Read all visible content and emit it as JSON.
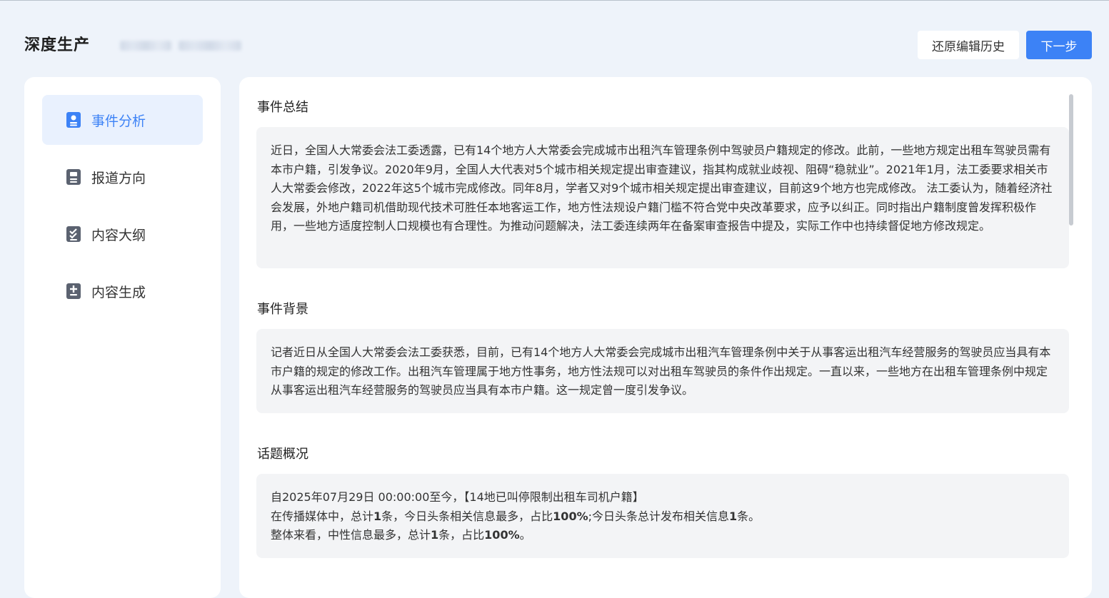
{
  "header": {
    "title": "深度生产",
    "restore_label": "还原编辑历史",
    "next_label": "下一步"
  },
  "sidebar": {
    "items": [
      {
        "label": "事件分析",
        "icon": "person-card-icon",
        "active": true
      },
      {
        "label": "报道方向",
        "icon": "document-icon",
        "active": false
      },
      {
        "label": "内容大纲",
        "icon": "checklist-icon",
        "active": false
      },
      {
        "label": "内容生成",
        "icon": "add-document-icon",
        "active": false
      }
    ]
  },
  "main": {
    "summary": {
      "title": "事件总结",
      "text": "近日，全国人大常委会法工委透露，已有14个地方人大常委会完成城市出租汽车管理条例中驾驶员户籍规定的修改。此前，一些地方规定出租车驾驶员需有本市户籍，引发争议。2020年9月，全国人大代表对5个城市相关规定提出审查建议，指其构成就业歧视、阻碍“稳就业”。2021年1月，法工委要求相关市人大常委会修改，2022年这5个城市完成修改。同年8月，学者又对9个城市相关规定提出审查建议，目前这9个地方也完成修改。 法工委认为，随着经济社会发展，外地户籍司机借助现代技术可胜任本地客运工作，地方性法规设户籍门槛不符合党中央改革要求，应予以纠正。同时指出户籍制度曾发挥积极作用，一些地方适度控制人口规模也有合理性。为推动问题解决，法工委连续两年在备案审查报告中提及，实际工作中也持续督促地方修改规定。"
    },
    "background": {
      "title": "事件背景",
      "text": "记者近日从全国人大常委会法工委获悉，目前，已有14个地方人大常委会完成城市出租汽车管理条例中关于从事客运出租汽车经营服务的驾驶员应当具有本市户籍的规定的修改工作。出租汽车管理属于地方性事务，地方性法规可以对出租车驾驶员的条件作出规定。一直以来，一些地方在出租车管理条例中规定从事客运出租汽车经营服务的驾驶员应当具有本市户籍。这一规定曾一度引发争议。"
    },
    "overview": {
      "title": "话题概况",
      "line1": "自2025年07月29日 00:00:00至今，【14地已叫停限制出租车司机户籍】",
      "line2_a": "在传播媒体中，总计",
      "line2_b": "1",
      "line2_c": "条，今日头条相关信息最多，占比",
      "line2_d": "100%",
      "line2_e": ";今日头条总计发布相关信息",
      "line2_f": "1",
      "line2_g": "条。",
      "line3_a": "整体来看，中性信息最多，总计",
      "line3_b": "1",
      "line3_c": "条，占比",
      "line3_d": "100%",
      "line3_e": "。"
    }
  },
  "colors": {
    "accent": "#3c82f6",
    "background": "#eef3fa",
    "panel": "#f3f4f6"
  }
}
